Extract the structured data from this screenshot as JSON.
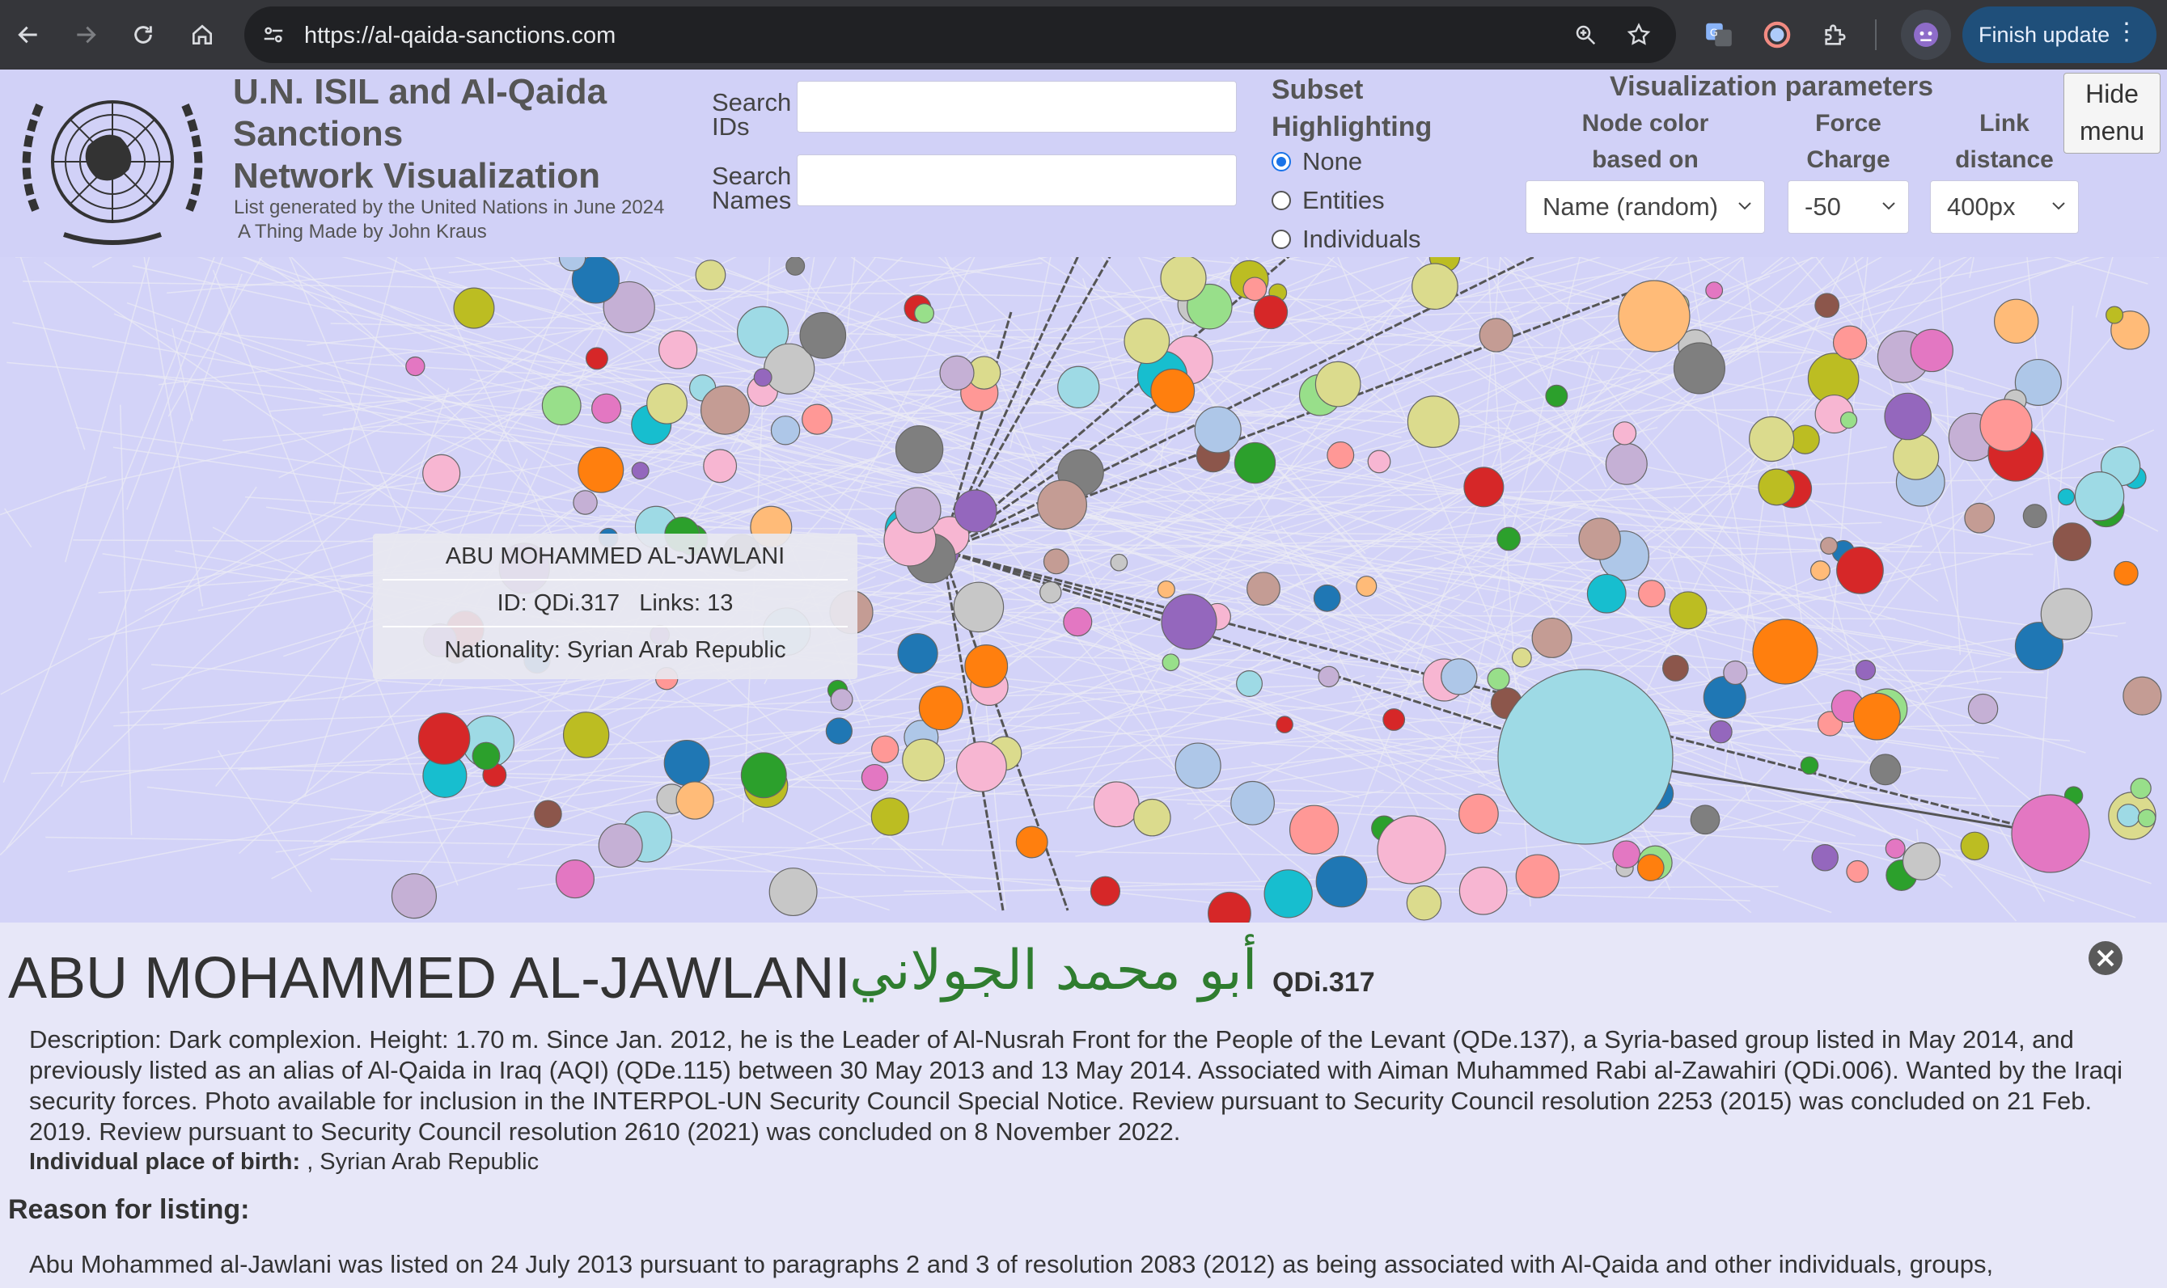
{
  "browser": {
    "url": "https://al-qaida-sanctions.com",
    "finish_update_label": "Finish update",
    "icons": [
      "back-icon",
      "forward-icon",
      "reload-icon",
      "home-icon",
      "site-settings-icon",
      "zoom-icon",
      "bookmark-star-icon",
      "translate-icon",
      "color-extension-icon",
      "extensions-puzzle-icon",
      "profile-avatar-icon",
      "more-menu-icon"
    ]
  },
  "header": {
    "title_lines": [
      "U.N. ISIL and Al-Qaida",
      "Sanctions",
      "Network Visualization"
    ],
    "list_generated": "List generated by the United Nations in June 2024",
    "credit_prefix": "A Thing Made by ",
    "credit_author": "John Kraus"
  },
  "search": {
    "ids_label_1": "Search",
    "ids_label_2": "IDs",
    "ids_value": "",
    "names_label_1": "Search",
    "names_label_2": "Names",
    "names_value": ""
  },
  "subset": {
    "title_1": "Subset",
    "title_2": "Highlighting",
    "options": [
      {
        "label": "None",
        "checked": true
      },
      {
        "label": "Entities",
        "checked": false
      },
      {
        "label": "Individuals",
        "checked": false
      }
    ]
  },
  "visualization": {
    "title": "Visualization parameters",
    "node_color_label_1": "Node color",
    "node_color_label_2": "based on",
    "node_color_value": "Name (random)",
    "force_label_1": "Force",
    "force_label_2": "Charge",
    "force_value": "-50",
    "link_label_1": "Link",
    "link_label_2": "distance",
    "link_value": "400px"
  },
  "hide_menu": {
    "line1": "Hide",
    "line2": "menu"
  },
  "tooltip": {
    "name": "ABU MOHAMMED AL-JAWLANI",
    "id_links": "ID: QDi.317   Links: 13",
    "nationality": "Nationality: Syrian Arab Republic"
  },
  "detail": {
    "name": "ABU MOHAMMED AL-JAWLANI",
    "arabic_name": "أبو محمد الجولاني",
    "id": "QDi.317",
    "description": "Description: Dark complexion. Height: 1.70 m. Since Jan. 2012, he is the Leader of Al-Nusrah Front for the People of the Levant (QDe.137), a Syria-based group listed in May 2014, and previously listed as an alias of Al-Qaida in Iraq (AQI) (QDe.115) between 30 May 2013 and 13 May 2014. Associated with Aiman Muhammed Rabi al-Zawahiri (QDi.006). Wanted by the Iraqi security forces. Photo available for inclusion in the INTERPOL-UN Security Council Special Notice. Review pursuant to Security Council resolution 2253 (2015) was concluded on 21 Feb. 2019. Review pursuant to Security Council resolution 2610 (2021) was concluded on 8 November 2022.",
    "birthplace_label": "Individual place of birth:",
    "birthplace_value": " , Syrian Arab Republic",
    "reason_title": "Reason for listing:",
    "reason_text": "Abu Mohammed al-Jawlani was listed on 24 July 2013 pursuant to paragraphs 2 and 3 of resolution 2083 (2012) as being associated with Al-Qaida and other individuals, groups,"
  },
  "colors": {
    "page_bg": "#d3d3f8",
    "detail_bg": "#e7e7f8",
    "arabic_green": "#2f7d2f",
    "chrome_bg": "#35363a"
  }
}
